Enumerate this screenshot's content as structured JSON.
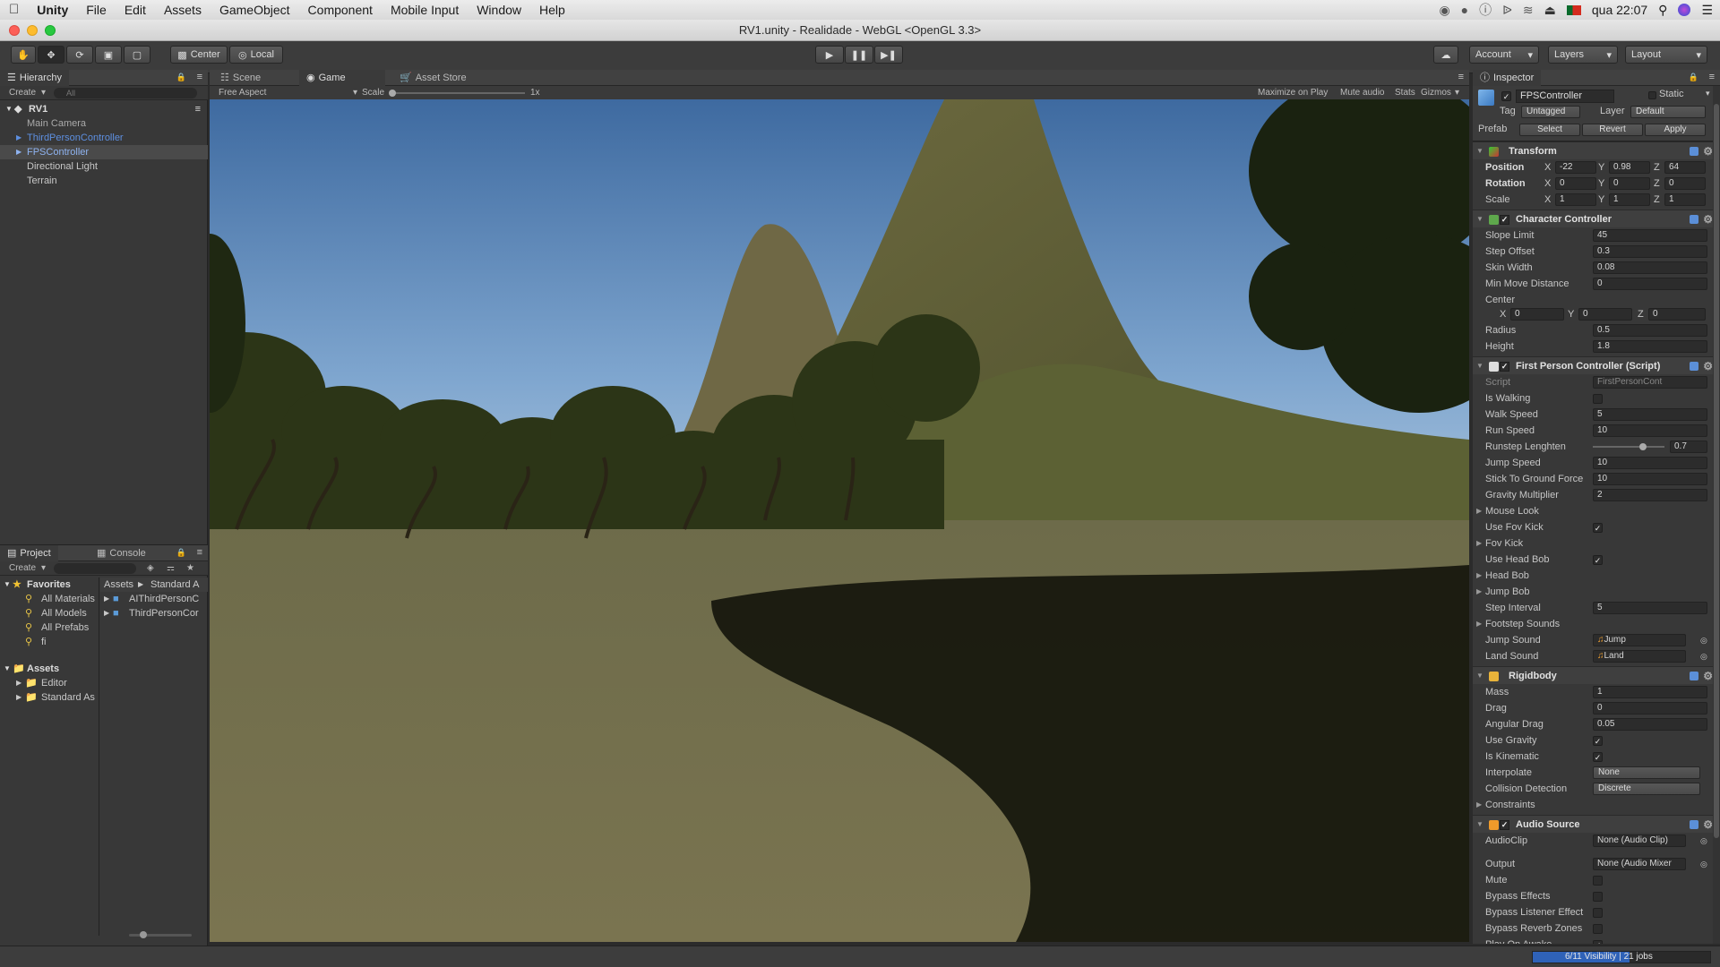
{
  "menubar": {
    "app": "Unity",
    "items": [
      "File",
      "Edit",
      "Assets",
      "GameObject",
      "Component",
      "Mobile Input",
      "Window",
      "Help"
    ],
    "clock": "qua 22:07"
  },
  "window": {
    "title": "RV1.unity - Realidade - WebGL <OpenGL 3.3>"
  },
  "toolbar": {
    "pivot": "Center",
    "space": "Local",
    "account": "Account",
    "layers": "Layers",
    "layout": "Layout"
  },
  "hierarchy": {
    "tab": "Hierarchy",
    "create": "Create",
    "search": "All",
    "scene": "RV1",
    "items": [
      "Main Camera",
      "ThirdPersonController",
      "FPSController",
      "Directional Light",
      "Terrain"
    ]
  },
  "center_tabs": {
    "scene": "Scene",
    "game": "Game",
    "store": "Asset Store"
  },
  "game": {
    "aspect": "Free Aspect",
    "scale_label": "Scale",
    "scale_value": "1x",
    "maximize": "Maximize on Play",
    "mute": "Mute audio",
    "stats": "Stats",
    "gizmos": "Gizmos"
  },
  "project": {
    "tab": "Project",
    "console": "Console",
    "create": "Create",
    "favorites": "Favorites",
    "fav_items": [
      "All Materials",
      "All Models",
      "All Prefabs",
      "fi"
    ],
    "assets": "Assets",
    "asset_items": [
      "Editor",
      "Standard As"
    ],
    "breadcrumb": [
      "Assets",
      "Standard A"
    ],
    "files": [
      "AIThirdPersonC",
      "ThirdPersonCor"
    ]
  },
  "inspector": {
    "tab": "Inspector",
    "object": "FPSController",
    "static": "Static",
    "tag_label": "Tag",
    "tag": "Untagged",
    "layer_label": "Layer",
    "layer": "Default",
    "prefab_label": "Prefab",
    "select": "Select",
    "revert": "Revert",
    "apply": "Apply",
    "transform": {
      "title": "Transform",
      "position": {
        "label": "Position",
        "x": "-22",
        "y": "0.98",
        "z": "64"
      },
      "rotation": {
        "label": "Rotation",
        "x": "0",
        "y": "0",
        "z": "0"
      },
      "scale": {
        "label": "Scale",
        "x": "1",
        "y": "1",
        "z": "1"
      }
    },
    "cc": {
      "title": "Character Controller",
      "slope_label": "Slope Limit",
      "slope": "45",
      "step_label": "Step Offset",
      "step": "0.3",
      "skin_label": "Skin Width",
      "skin": "0.08",
      "minmove_label": "Min Move Distance",
      "minmove": "0",
      "center_label": "Center",
      "cx": "0",
      "cy": "0",
      "cz": "0",
      "radius_label": "Radius",
      "radius": "0.5",
      "height_label": "Height",
      "height": "1.8"
    },
    "fpc": {
      "title": "First Person Controller (Script)",
      "script_label": "Script",
      "script": "FirstPersonCont",
      "walking_label": "Is Walking",
      "walk_label": "Walk Speed",
      "walk": "5",
      "run_label": "Run Speed",
      "run": "10",
      "runstep_label": "Runstep Lenghten",
      "runstep": "0.7",
      "runstep_fraction": 0.7,
      "jump_label": "Jump Speed",
      "jump": "10",
      "stick_label": "Stick To Ground Force",
      "stick": "10",
      "grav_label": "Gravity Multiplier",
      "grav": "2",
      "mouselook_label": "Mouse Look",
      "fovkick_use_label": "Use Fov Kick",
      "fovkick_label": "Fov Kick",
      "headbob_use_label": "Use Head Bob",
      "headbob_label": "Head Bob",
      "jumpbob_label": "Jump Bob",
      "stepint_label": "Step Interval",
      "stepint": "5",
      "footsteps_label": "Footstep Sounds",
      "jumpsound_label": "Jump Sound",
      "jumpsound": "Jump",
      "landsound_label": "Land Sound",
      "landsound": "Land"
    },
    "rb": {
      "title": "Rigidbody",
      "mass_label": "Mass",
      "mass": "1",
      "drag_label": "Drag",
      "drag": "0",
      "adrag_label": "Angular Drag",
      "adrag": "0.05",
      "gravity_label": "Use Gravity",
      "kinematic_label": "Is Kinematic",
      "interp_label": "Interpolate",
      "interp": "None",
      "coll_label": "Collision Detection",
      "coll": "Discrete",
      "constraints_label": "Constraints"
    },
    "audio": {
      "title": "Audio Source",
      "clip_label": "AudioClip",
      "clip": "None (Audio Clip)",
      "output_label": "Output",
      "output": "None (Audio Mixer",
      "mute_label": "Mute",
      "bypass_label": "Bypass Effects",
      "bypassl_label": "Bypass Listener Effect",
      "bypassr_label": "Bypass Reverb Zones",
      "awake_label": "Play On Awake"
    }
  },
  "status": {
    "progress": "6/11 Visibility | 21 jobs"
  }
}
